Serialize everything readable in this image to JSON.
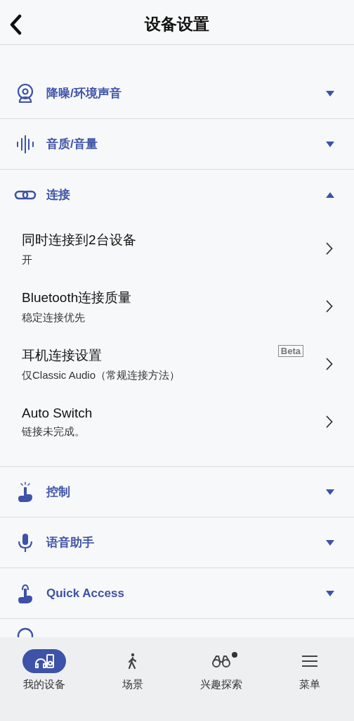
{
  "header": {
    "title": "设备设置"
  },
  "sections": [
    {
      "label": "降噪/环境声音",
      "expanded": false
    },
    {
      "label": "音质/音量",
      "expanded": false
    },
    {
      "label": "连接",
      "expanded": true,
      "items": [
        {
          "title": "同时连接到2台设备",
          "value": "开"
        },
        {
          "title": "Bluetooth连接质量",
          "value": "稳定连接优先"
        },
        {
          "title": "耳机连接设置",
          "value": "仅Classic Audio（常规连接方法）",
          "badge": "Beta"
        },
        {
          "title": "Auto Switch",
          "value": "链接未完成。"
        }
      ]
    },
    {
      "label": "控制",
      "expanded": false
    },
    {
      "label": "语音助手",
      "expanded": false
    },
    {
      "label": "Quick Access",
      "expanded": false
    }
  ],
  "tab_bar": [
    {
      "label": "我的设备",
      "selected": true,
      "dot": false
    },
    {
      "label": "场景",
      "selected": false,
      "dot": false
    },
    {
      "label": "兴趣探索",
      "selected": false,
      "dot": true
    },
    {
      "label": "菜单",
      "selected": false,
      "dot": false
    }
  ]
}
